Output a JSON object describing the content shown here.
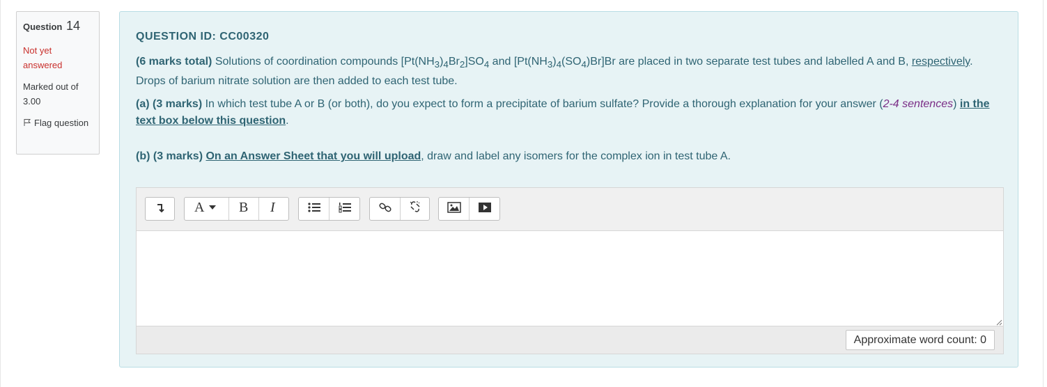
{
  "info": {
    "question_label": "Question",
    "question_number": "14",
    "state": "Not yet answered",
    "grade": "Marked out of 3.00",
    "flag_label": "Flag question"
  },
  "question": {
    "id_line": "QUESTION ID: CC00320",
    "intro_bold": "(6 marks total)",
    "intro_text_1": " Solutions of coordination compounds [Pt(NH",
    "intro_text_2": "3",
    "intro_text_3": ")",
    "intro_text_4": "4",
    "intro_text_5": "Br",
    "intro_text_6": "2",
    "intro_text_7": "]SO",
    "intro_text_8": "4",
    "intro_text_9": " and [Pt(NH",
    "intro_text_10": "3",
    "intro_text_11": ")",
    "intro_text_12": "4",
    "intro_text_13": "(SO",
    "intro_text_14": "4",
    "intro_text_15": ")Br]Br are placed in two separate test tubes and labelled A and B, ",
    "intro_underlined": "respectively",
    "intro_text_16": ". Drops of barium nitrate solution are then added to each test tube.",
    "part_a_bold": "(a) (3 marks)",
    "part_a_text": " In which test tube A or B (or both), do you expect to form a precipitate of barium sulfate? Provide a thorough explanation for your answer (",
    "part_a_purple": "2-4 sentences",
    "part_a_text_2": ") ",
    "part_a_link": "in the text box below this question",
    "part_a_end": ".",
    "part_b_bold": "(b) (3 marks)",
    "part_b_space": " ",
    "part_b_link": "On an Answer Sheet that you will upload",
    "part_b_text": ", draw and label any isomers for the complex ion in test tube A."
  },
  "editor": {
    "toolbar": {
      "toggle_icon": "toolbar-toggle-icon",
      "style_icon": "font-style-icon",
      "bold_icon": "bold-icon",
      "italic_icon": "italic-icon",
      "unordered_list_icon": "unordered-list-icon",
      "ordered_list_icon": "ordered-list-icon",
      "link_icon": "link-icon",
      "unlink_icon": "unlink-icon",
      "image_icon": "image-icon",
      "media_icon": "media-icon"
    },
    "content": "",
    "word_count": "Approximate word count: 0"
  }
}
